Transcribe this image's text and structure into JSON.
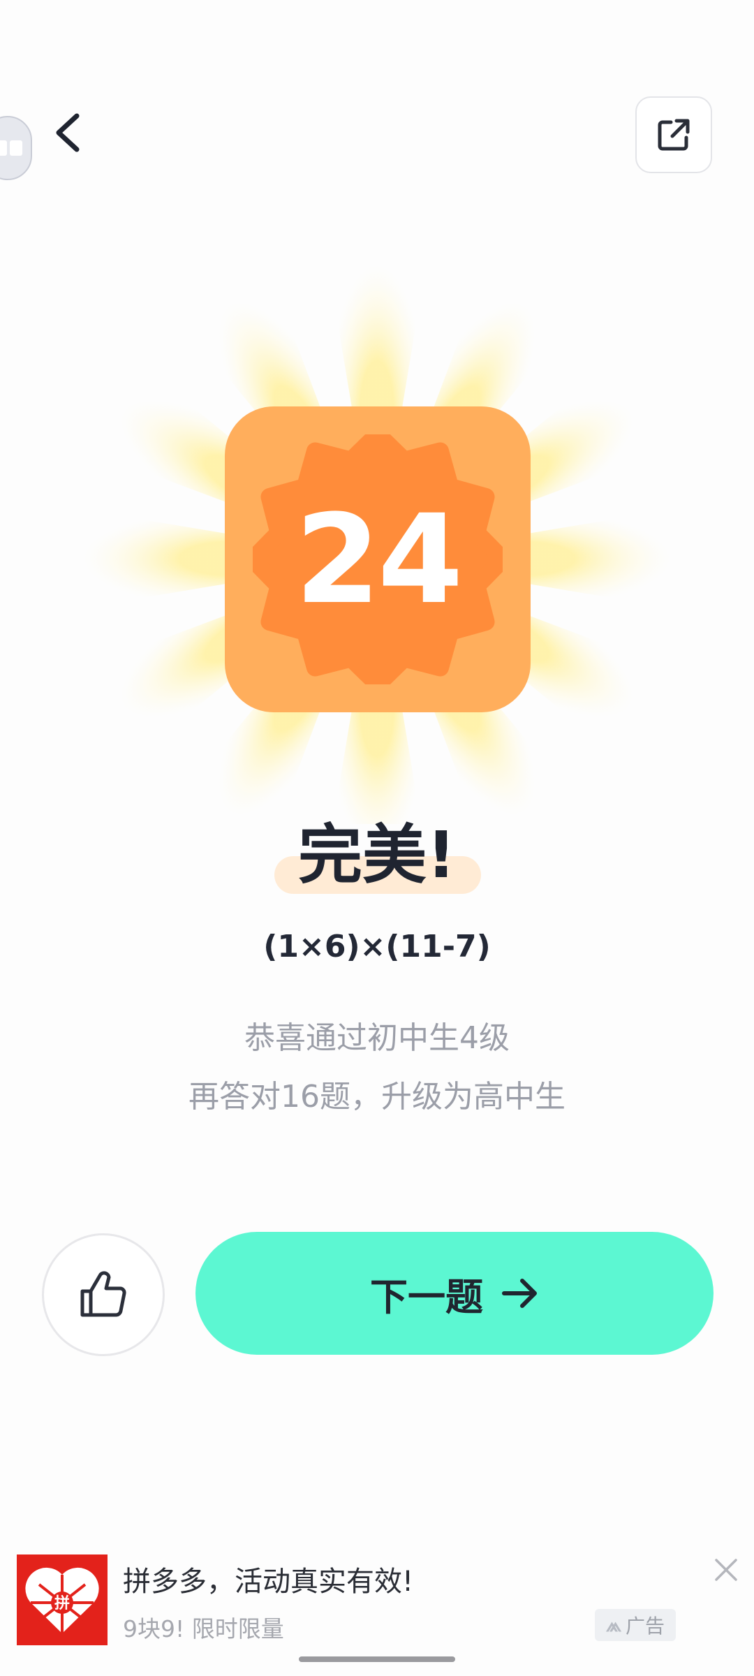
{
  "tile": {
    "number": "24"
  },
  "result": {
    "title": "完美!",
    "formula": "(1×6)×(11-7)",
    "message_line1": "恭喜通过初中生4级",
    "message_line2": "再答对16题，升级为高中生"
  },
  "actions": {
    "next_label": "下一题"
  },
  "ad": {
    "title": "拼多多，活动真实有效!",
    "subtitle": "9块9!  限时限量",
    "tag_label": "广告",
    "logo_text": "拼"
  },
  "colors": {
    "tile_outer": "#ffae5c",
    "tile_badge": "#ff8c3a",
    "next_button": "#5cf7d2",
    "ad_logo": "#e3221b"
  }
}
